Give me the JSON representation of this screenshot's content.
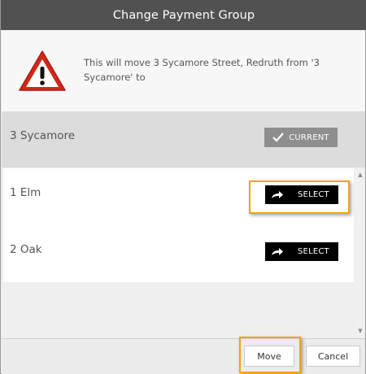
{
  "dialog": {
    "title": "Change Payment Group",
    "message": "This will move 3 Sycamore Street, Redruth from '3 Sycamore' to",
    "icon": "warning-icon",
    "current_group": {
      "name": "3 Sycamore",
      "button_label": "CURRENT",
      "button_icon": "check-icon"
    },
    "options": [
      {
        "name": "1 Elm",
        "button_label": "SELECT",
        "button_icon": "arrow-forward-icon",
        "highlighted": true
      },
      {
        "name": "2 Oak",
        "button_label": "SELECT",
        "button_icon": "arrow-forward-icon",
        "highlighted": false
      }
    ],
    "footer": {
      "move_label": "Move",
      "cancel_label": "Cancel"
    },
    "colors": {
      "titlebar": "#515151",
      "highlight": "#f5a30a",
      "select_button": "#000000",
      "current_button": "#8e8e8e"
    }
  }
}
